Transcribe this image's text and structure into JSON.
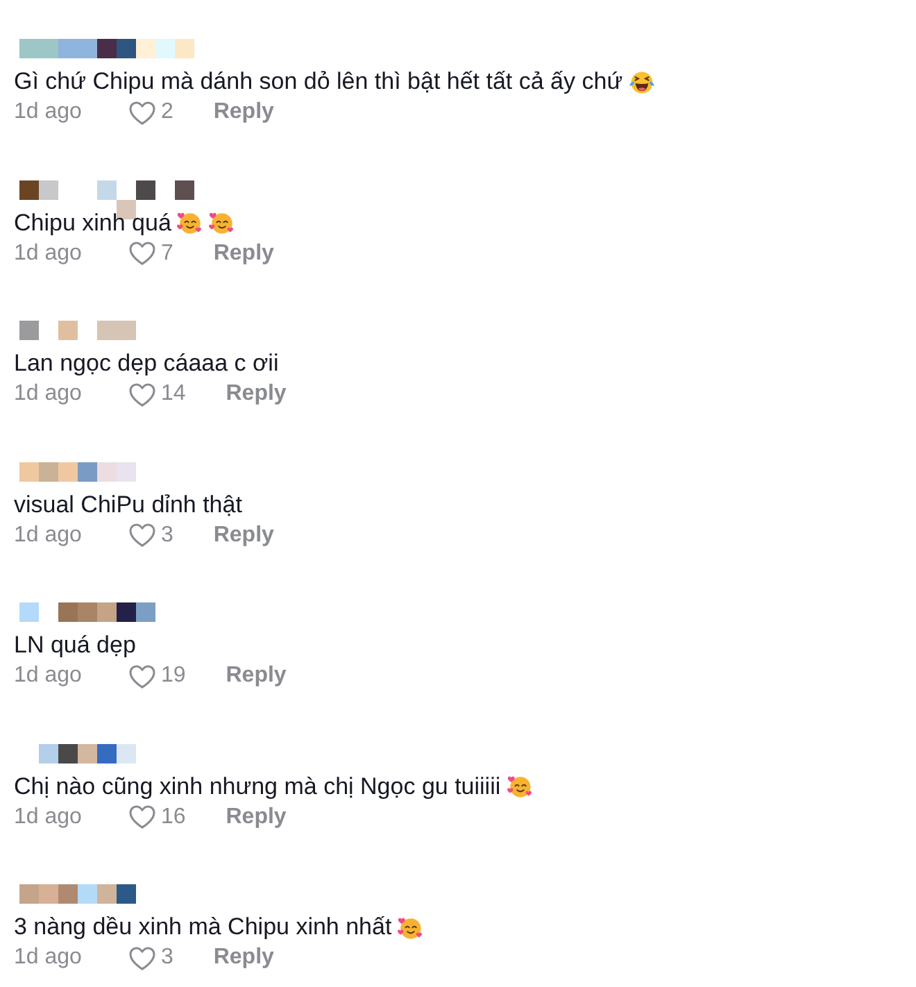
{
  "comments": [
    {
      "name_mosaic": [
        {
          "tiles": [
            {
              "kind": "tile",
              "color": "#9cc7c6"
            },
            {
              "kind": "tile",
              "color": "#9cc7c6"
            },
            {
              "kind": "tile",
              "color": "#8fb4de"
            },
            {
              "kind": "tile",
              "color": "#8fb4de"
            },
            {
              "kind": "tile",
              "color": "#4a2d48"
            },
            {
              "kind": "tile",
              "color": "#2f5680"
            },
            {
              "kind": "tile",
              "color": "#fff0d6"
            },
            {
              "kind": "tile",
              "color": "#e0f9fc"
            },
            {
              "kind": "tile",
              "color": "#fde8c6"
            }
          ]
        }
      ],
      "text": "Gì chứ Chipu mà dánh son dỏ lên thì bật hết tất cả ấy chứ",
      "emoji": [
        {
          "kind": "tears_of_joy"
        }
      ],
      "time": "1d ago",
      "likes": "2",
      "reply": "Reply"
    },
    {
      "name_mosaic": [
        {
          "tiles": [
            {
              "kind": "tile",
              "color": "#6b4423"
            },
            {
              "kind": "tile",
              "color": "#c8c8ca"
            },
            {
              "kind": "blank"
            },
            {
              "kind": "blank"
            },
            {
              "kind": "tile",
              "color": "#c4d8ea"
            },
            {
              "kind": "blank"
            },
            {
              "kind": "tile",
              "color": "#4e4a4c"
            },
            {
              "kind": "blank"
            },
            {
              "kind": "tile",
              "color": "#5e5050"
            }
          ]
        },
        {
          "tiles": [
            {
              "kind": "blank"
            },
            {
              "kind": "blank"
            },
            {
              "kind": "blank"
            },
            {
              "kind": "blank"
            },
            {
              "kind": "blank"
            },
            {
              "kind": "tile",
              "color": "#d9c6b8"
            }
          ]
        }
      ],
      "text": "Chipu xinh quá",
      "emoji": [
        {
          "kind": "smiling_hearts"
        },
        {
          "kind": "smiling_hearts"
        }
      ],
      "time": "1d ago",
      "likes": "7",
      "reply": "Reply"
    },
    {
      "name_mosaic": [
        {
          "tiles": [
            {
              "kind": "tile",
              "color": "#9b9a9c"
            },
            {
              "kind": "blank"
            },
            {
              "kind": "tile",
              "color": "#e0bfa0"
            },
            {
              "kind": "blank"
            },
            {
              "kind": "tile",
              "color": "#d6c4b4"
            },
            {
              "kind": "tile",
              "color": "#d6c4b4"
            }
          ]
        }
      ],
      "text": "Lan ngọc dẹp cáaaa c ơii",
      "time": "1d ago",
      "likes": "14",
      "reply": "Reply"
    },
    {
      "name_mosaic": [
        {
          "tiles": [
            {
              "kind": "tile",
              "color": "#f0c8a0"
            },
            {
              "kind": "tile",
              "color": "#c9b296"
            },
            {
              "kind": "tile",
              "color": "#f0c8a0"
            },
            {
              "kind": "tile",
              "color": "#7a9cc4"
            },
            {
              "kind": "tile",
              "color": "#ecdde2"
            },
            {
              "kind": "tile",
              "color": "#e8e3ef"
            }
          ]
        }
      ],
      "text": "visual ChiPu dỉnh thật",
      "time": "1d ago",
      "likes": "3",
      "reply": "Reply"
    },
    {
      "name_mosaic": [
        {
          "tiles": [
            {
              "kind": "tile",
              "color": "#b3dafa"
            },
            {
              "kind": "blank"
            },
            {
              "kind": "tile",
              "color": "#9a7456"
            },
            {
              "kind": "tile",
              "color": "#a98565"
            },
            {
              "kind": "tile",
              "color": "#c4a387"
            },
            {
              "kind": "tile",
              "color": "#23204a"
            },
            {
              "kind": "tile",
              "color": "#7b9fc4"
            }
          ]
        }
      ],
      "text": "LN quá dẹp",
      "time": "1d ago",
      "likes": "19",
      "reply": "Reply"
    },
    {
      "name_mosaic": [
        {
          "tiles": [
            {
              "kind": "blank"
            },
            {
              "kind": "tile",
              "color": "#b3cfea"
            },
            {
              "kind": "tile",
              "color": "#4a4849"
            },
            {
              "kind": "tile",
              "color": "#d4b79f"
            },
            {
              "kind": "tile",
              "color": "#356cc0"
            },
            {
              "kind": "tile",
              "color": "#dbe8f3"
            }
          ]
        }
      ],
      "text": "Chị nào cũng xinh nhưng mà chị Ngọc gu tuiiiii",
      "emoji": [
        {
          "kind": "smiling_hearts"
        }
      ],
      "time": "1d ago",
      "likes": "16",
      "reply": "Reply"
    },
    {
      "name_mosaic": [
        {
          "tiles": [
            {
              "kind": "tile",
              "color": "#c4a48a"
            },
            {
              "kind": "tile",
              "color": "#d8b095"
            },
            {
              "kind": "tile",
              "color": "#b08a70"
            },
            {
              "kind": "tile",
              "color": "#b3dbf8"
            },
            {
              "kind": "tile",
              "color": "#d0b39b"
            },
            {
              "kind": "tile",
              "color": "#2b5a88"
            }
          ]
        }
      ],
      "text": "3 nàng dều xinh mà Chipu xinh nhất",
      "emoji": [
        {
          "kind": "smiling_hearts"
        }
      ],
      "time": "1d ago",
      "likes": "3",
      "reply": "Reply"
    }
  ]
}
